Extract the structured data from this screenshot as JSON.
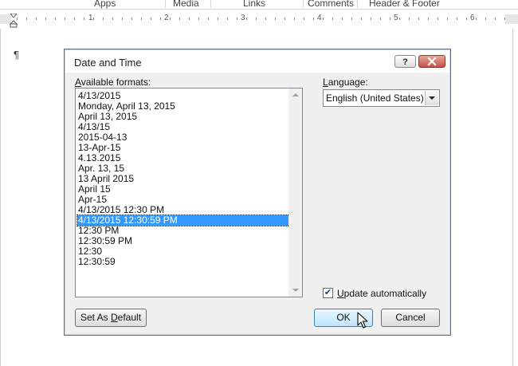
{
  "ribbon": {
    "groups": [
      "Apps",
      "Media",
      "Links",
      "Comments",
      "Header & Footer"
    ]
  },
  "ruler": {
    "numbers": [
      "1",
      "2",
      "3",
      "4",
      "5",
      "6"
    ]
  },
  "document": {
    "pilcrow": "¶"
  },
  "dialog": {
    "title": "Date and Time",
    "help_label": "?",
    "formats_label": "Available formats:",
    "formats": [
      "4/13/2015",
      "Monday, April 13, 2015",
      "April 13, 2015",
      "4/13/15",
      "2015-04-13",
      "13-Apr-15",
      "4.13.2015",
      "Apr. 13, 15",
      "13 April 2015",
      "April 15",
      "Apr-15",
      "4/13/2015 12:30 PM",
      "4/13/2015 12:30:59 PM",
      "12:30 PM",
      "12:30:59 PM",
      "12:30",
      "12:30:59"
    ],
    "selected_format": "4/13/2015 12:30:59 PM",
    "language_label": "Language:",
    "language_value": "English (United States)",
    "update_auto_label": "Update automatically",
    "update_auto_checked": true,
    "set_default_label": "Set As Default",
    "ok_label": "OK",
    "cancel_label": "Cancel"
  },
  "colors": {
    "selection": "#3399ff",
    "dialog_bg": "#f0f0f0",
    "close_button": "#c75050"
  }
}
